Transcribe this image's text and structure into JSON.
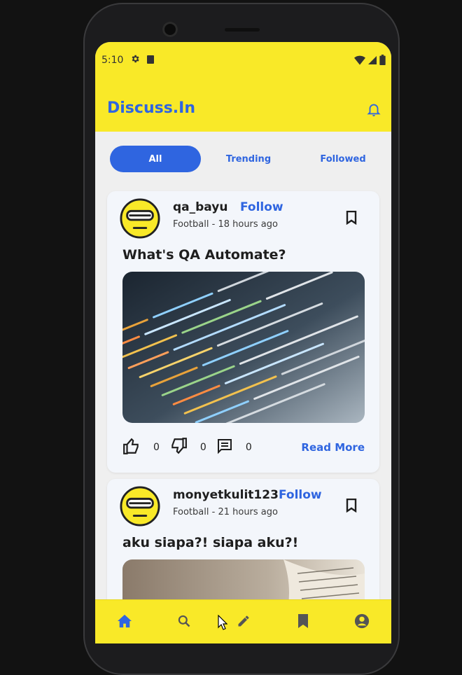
{
  "status_bar": {
    "time": "5:10"
  },
  "app": {
    "title": "Discuss.In"
  },
  "tabs": [
    {
      "label": "All",
      "active": true
    },
    {
      "label": "Trending",
      "active": false
    },
    {
      "label": "Followed",
      "active": false
    }
  ],
  "posts": [
    {
      "username": "qa_bayu",
      "follow_label": "Follow",
      "category": "Football",
      "separator": "-",
      "time_ago": "18 hours ago",
      "title": "What's QA Automate?",
      "image": "code-editor-screen-photo",
      "likes": "0",
      "dislikes": "0",
      "comments": "0",
      "read_more_label": "Read More"
    },
    {
      "username": "monyetkulit123",
      "follow_label": "Follow",
      "category": "Football",
      "separator": "-",
      "time_ago": "21 hours ago",
      "title": "aku siapa?! siapa aku?!",
      "image": "open-book-photo"
    }
  ],
  "bottom_nav": [
    {
      "icon": "home-icon",
      "active": true
    },
    {
      "icon": "search-icon",
      "active": false
    },
    {
      "icon": "edit-icon",
      "active": false
    },
    {
      "icon": "bookmark-icon",
      "active": false
    },
    {
      "icon": "account-icon",
      "active": false
    }
  ],
  "colors": {
    "accent": "#2f65e0",
    "app_bar": "#f9e928",
    "background": "#efefef",
    "card": "#f3f6fb"
  }
}
